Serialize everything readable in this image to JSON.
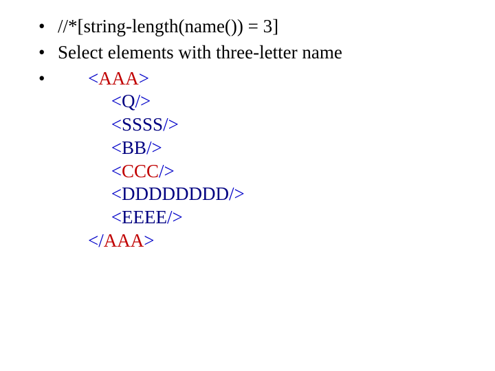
{
  "bullets": {
    "b1": "//*[string-length(name()) = 3]",
    "b2": "Select elements with three-letter name",
    "b3": ""
  },
  "xml": {
    "indent1": "     ",
    "indentClose": "",
    "root": "AAA",
    "children": [
      "Q",
      "SSSS",
      "BB",
      "CCC",
      "DDDDDDDD",
      "EEEE"
    ]
  },
  "colors": {
    "bracket": "#0000c8",
    "tag_highlight": "#c00000",
    "tag_normal": "#000080"
  }
}
